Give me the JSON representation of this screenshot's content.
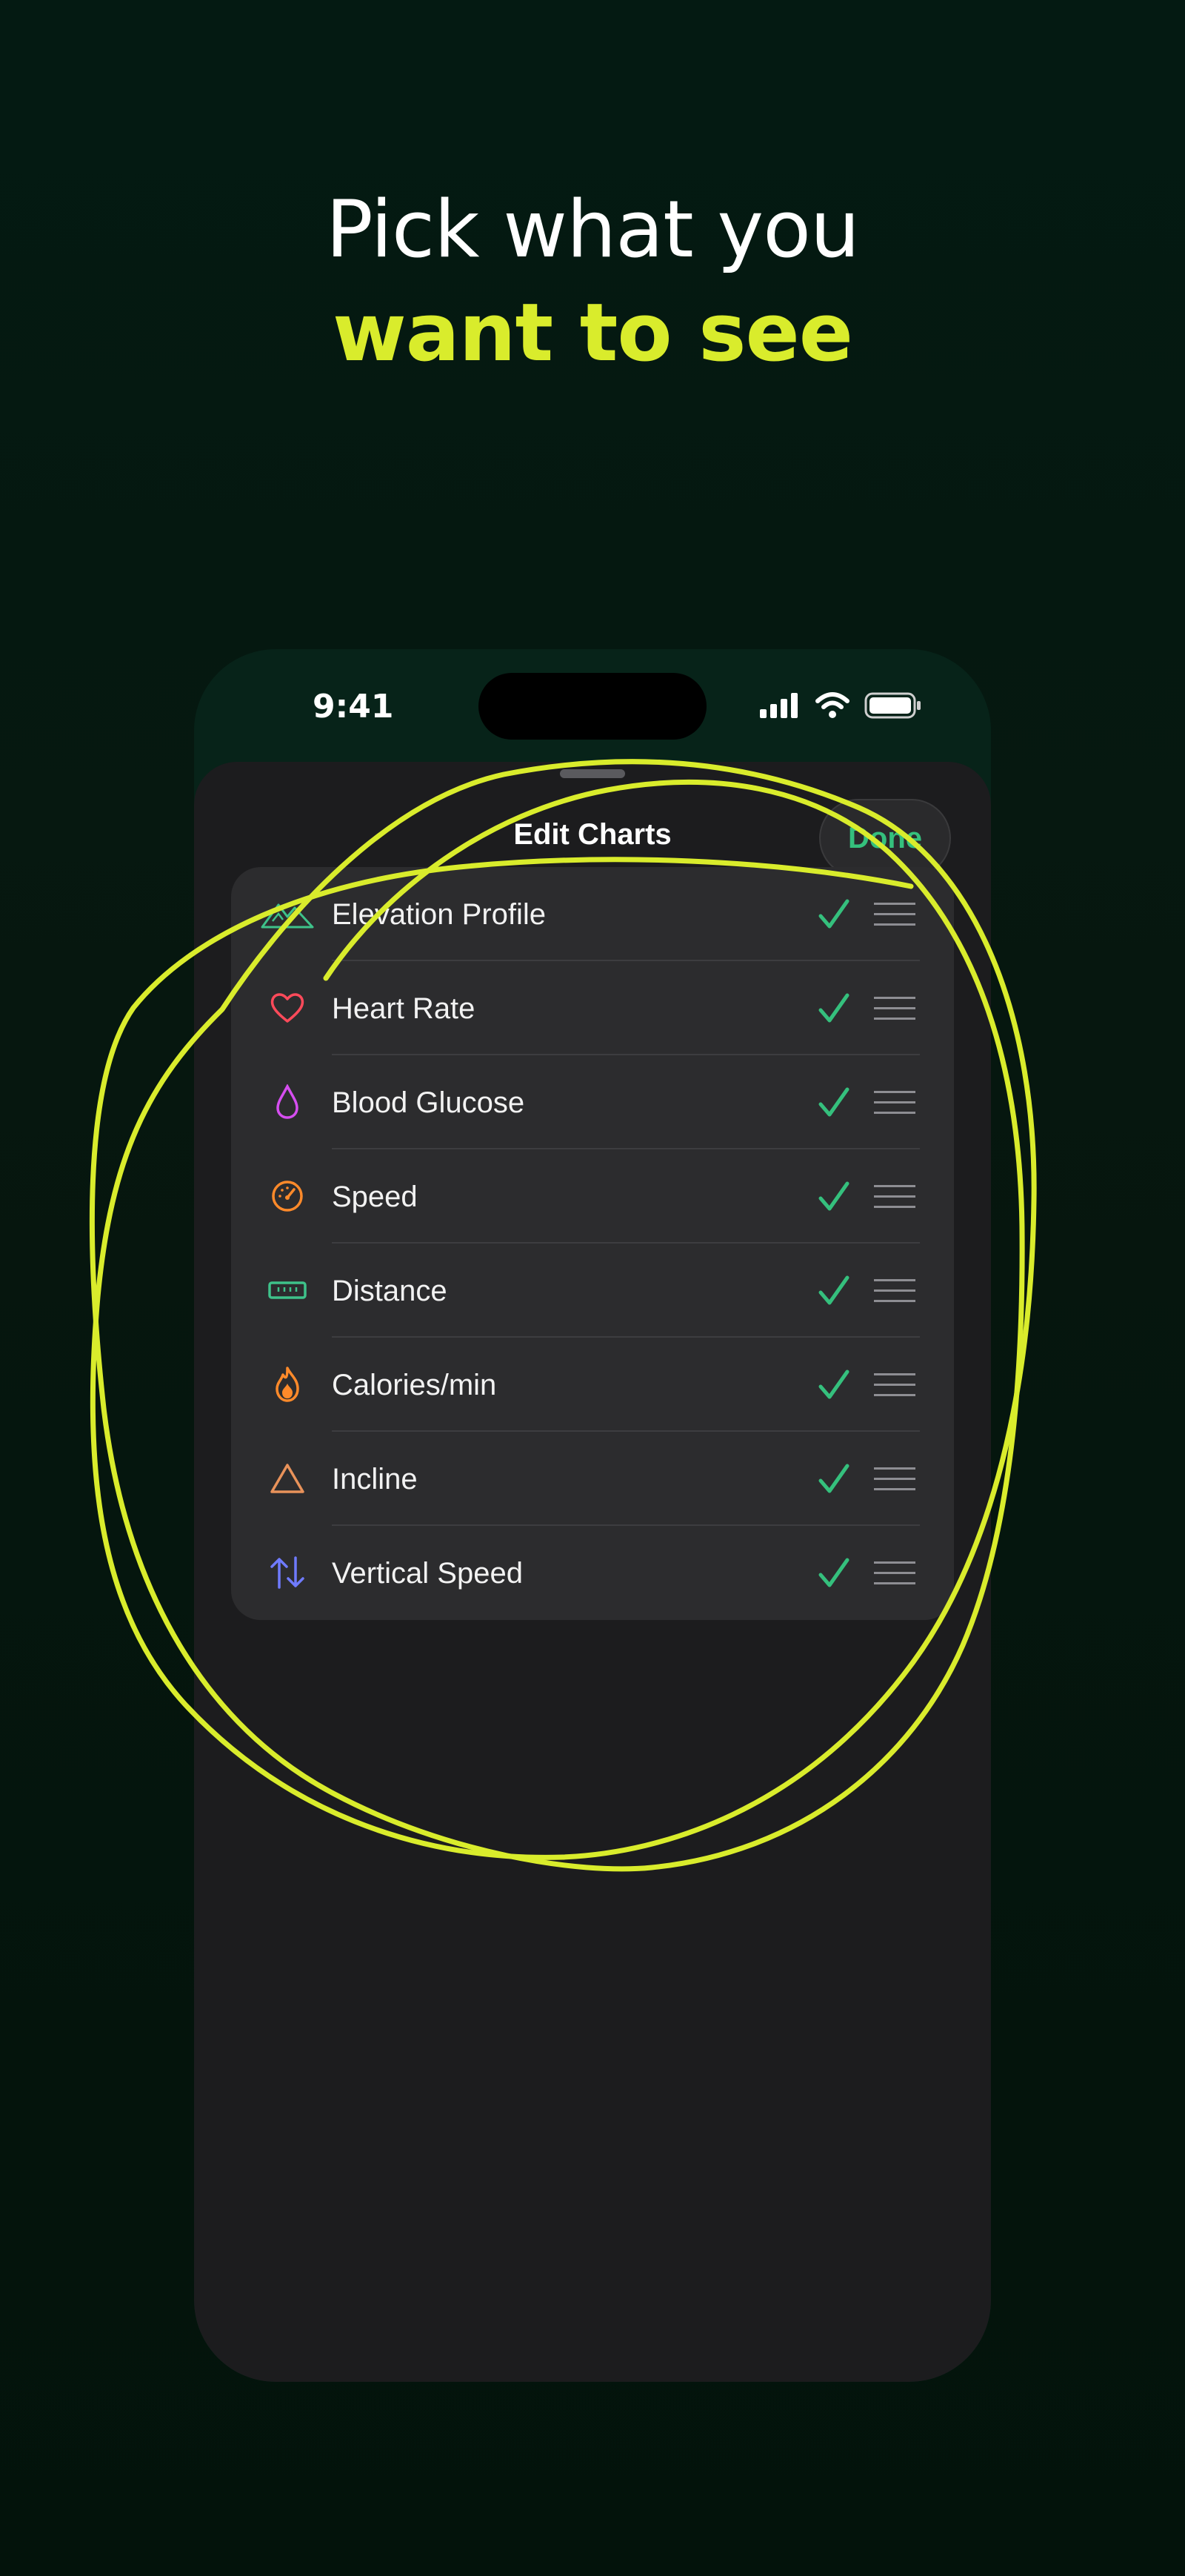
{
  "headline": {
    "line1": "Pick what you",
    "line2": "want to see"
  },
  "status_bar": {
    "time": "9:41",
    "icons": [
      "signal-icon",
      "wifi-icon",
      "battery-icon"
    ]
  },
  "sheet": {
    "title": "Edit Charts",
    "done_label": "Done"
  },
  "colors": {
    "background": "#041a12",
    "accent_yellow": "#d9ec2c",
    "check_green": "#35c07d",
    "sheet_bg": "#1c1c1e",
    "list_bg": "#2c2c2e"
  },
  "charts": [
    {
      "label": "Elevation Profile",
      "icon": "mountain-icon",
      "color": "#3ec28a",
      "checked": true
    },
    {
      "label": "Heart Rate",
      "icon": "heart-icon",
      "color": "#ff4a5a",
      "checked": true
    },
    {
      "label": "Blood Glucose",
      "icon": "drop-icon",
      "color": "#d64ef0",
      "checked": true
    },
    {
      "label": "Speed",
      "icon": "speedometer-icon",
      "color": "#ff8a2a",
      "checked": true
    },
    {
      "label": "Distance",
      "icon": "ruler-icon",
      "color": "#3ec28a",
      "checked": true
    },
    {
      "label": "Calories/min",
      "icon": "flame-icon",
      "color": "#ff8a2a",
      "checked": true
    },
    {
      "label": "Incline",
      "icon": "triangle-icon",
      "color": "#e8925a",
      "checked": true
    },
    {
      "label": "Vertical Speed",
      "icon": "up-down-arrows-icon",
      "color": "#6f7bff",
      "checked": true
    }
  ]
}
